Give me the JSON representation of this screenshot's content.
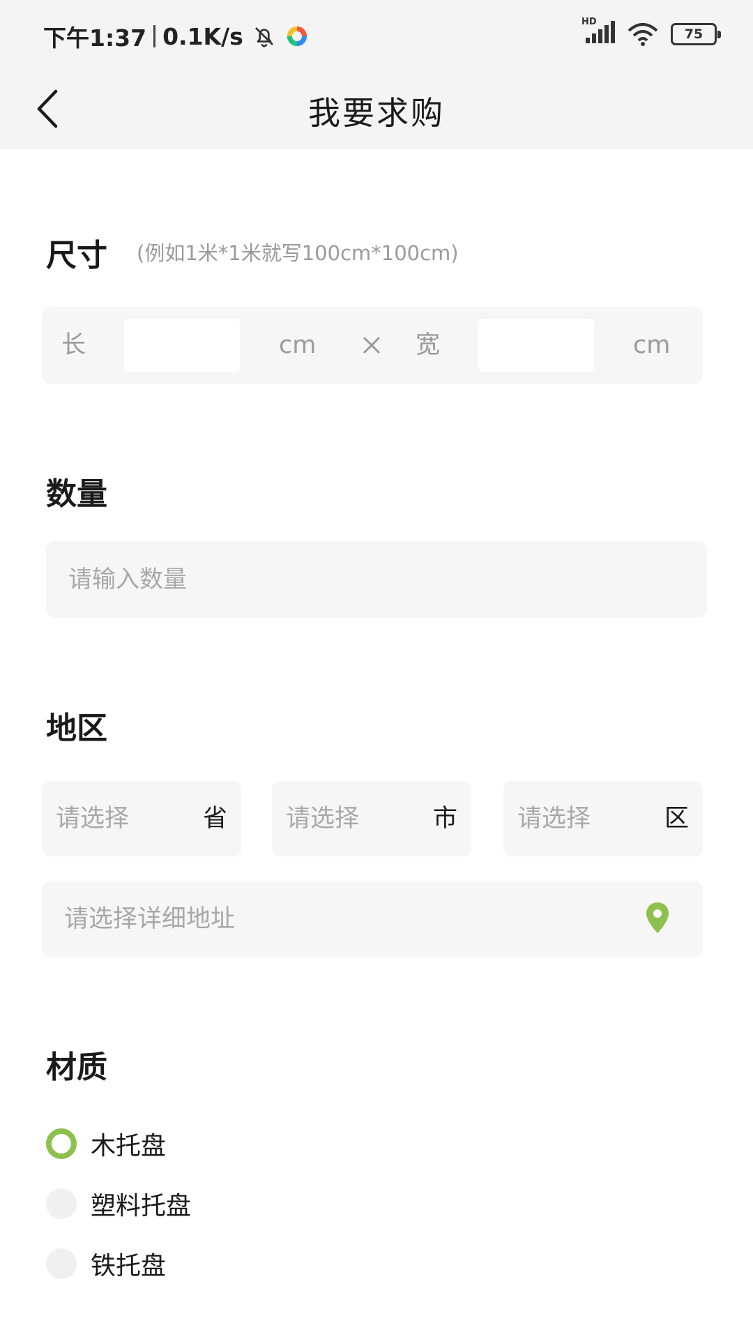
{
  "status_bar": {
    "time": "下午1:37",
    "net_speed": "0.1K/s",
    "network_badge": "HD",
    "battery": "75",
    "icons": [
      "mute-bell-icon",
      "app-logo-icon",
      "signal-icon",
      "wifi-icon",
      "battery-icon"
    ]
  },
  "nav": {
    "title": "我要求购",
    "back_icon": "chevron-left-icon"
  },
  "size": {
    "title": "尺寸",
    "hint": "(例如1米*1米就写100cm*100cm)",
    "length_label": "长",
    "length_value": "",
    "length_unit": "cm",
    "times_icon": "multiply-icon",
    "width_label": "宽",
    "width_value": "",
    "width_unit": "cm"
  },
  "quantity": {
    "title": "数量",
    "placeholder": "请输入数量",
    "value": ""
  },
  "region": {
    "title": "地区",
    "province": {
      "placeholder": "请选择",
      "unit": "省"
    },
    "city": {
      "placeholder": "请选择",
      "unit": "市"
    },
    "district": {
      "placeholder": "请选择",
      "unit": "区"
    },
    "address_placeholder": "请选择详细地址",
    "address_icon": "location-pin-icon"
  },
  "material": {
    "title": "材质",
    "options": [
      {
        "label": "木托盘",
        "selected": true
      },
      {
        "label": "塑料托盘",
        "selected": false
      },
      {
        "label": "铁托盘",
        "selected": false
      }
    ]
  },
  "colors": {
    "accent": "#8dc04c",
    "bar_bg": "#f4f4f4",
    "field_bg": "#f6f6f6",
    "placeholder": "#a8a8a8"
  }
}
